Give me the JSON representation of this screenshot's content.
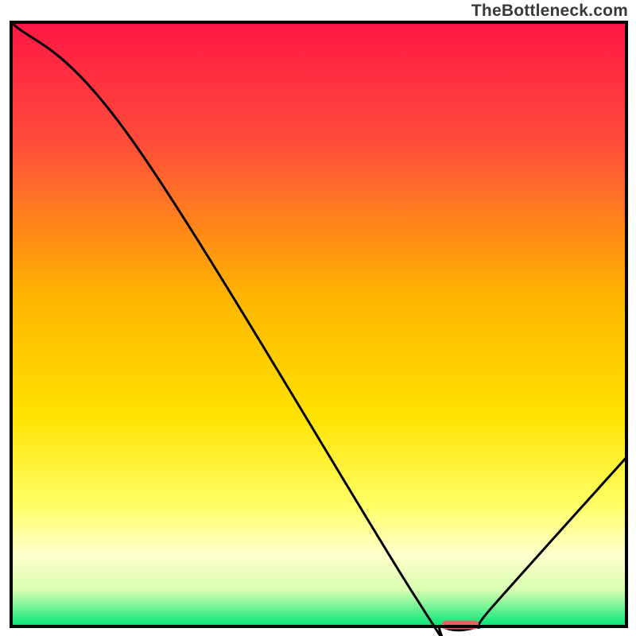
{
  "attribution": "TheBottleneck.com",
  "chart_data": {
    "type": "line",
    "title": "",
    "xlabel": "",
    "ylabel": "",
    "xlim": [
      0,
      100
    ],
    "ylim": [
      0,
      100
    ],
    "x": [
      0,
      20,
      65,
      70,
      76,
      78,
      100
    ],
    "values": [
      100,
      80,
      6,
      0,
      0,
      3,
      28
    ],
    "optimum_band": {
      "x_start": 70,
      "x_end": 76
    },
    "gradient_stops": [
      {
        "offset": 0,
        "color": "#ff1744"
      },
      {
        "offset": 20,
        "color": "#ff4d3a"
      },
      {
        "offset": 45,
        "color": "#ffb400"
      },
      {
        "offset": 65,
        "color": "#ffe200"
      },
      {
        "offset": 80,
        "color": "#ffff66"
      },
      {
        "offset": 88,
        "color": "#ffffcc"
      },
      {
        "offset": 94,
        "color": "#d8ffb0"
      },
      {
        "offset": 100,
        "color": "#00e676"
      }
    ],
    "marker": {
      "color": "#e06666",
      "x_center": 73,
      "width": 6,
      "thickness": 2
    }
  }
}
